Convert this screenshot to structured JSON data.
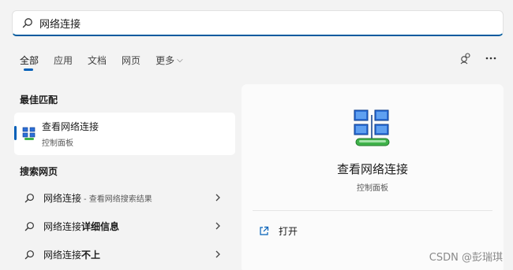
{
  "search": {
    "value": "网络连接",
    "icon": "search-icon"
  },
  "tabs": [
    {
      "label": "全部",
      "active": true
    },
    {
      "label": "应用",
      "active": false
    },
    {
      "label": "文档",
      "active": false
    },
    {
      "label": "网页",
      "active": false
    },
    {
      "label": "更多",
      "active": false
    }
  ],
  "header_icons": [
    "share-people-icon",
    "more-ellipsis-icon"
  ],
  "best_match": {
    "section_title": "最佳匹配",
    "name": "查看网络连接",
    "subtitle": "控制面板",
    "icon": "network-connections-icon"
  },
  "web": {
    "section_title": "搜索网页",
    "items": [
      {
        "text": "网络连接",
        "bold": "",
        "suffix": "- 查看网络搜索结果"
      },
      {
        "text": "网络连接",
        "bold": "详细信息",
        "suffix": ""
      },
      {
        "text": "网络连接",
        "bold": "不上",
        "suffix": ""
      }
    ]
  },
  "detail": {
    "title": "查看网络连接",
    "subtitle": "控制面板",
    "actions": [
      {
        "label": "打开",
        "icon": "open-external-icon"
      }
    ]
  },
  "watermark": "CSDN @彭瑞琪",
  "colors": {
    "accent": "#005fb8",
    "background": "#f3f3f3",
    "card": "#ffffff"
  }
}
